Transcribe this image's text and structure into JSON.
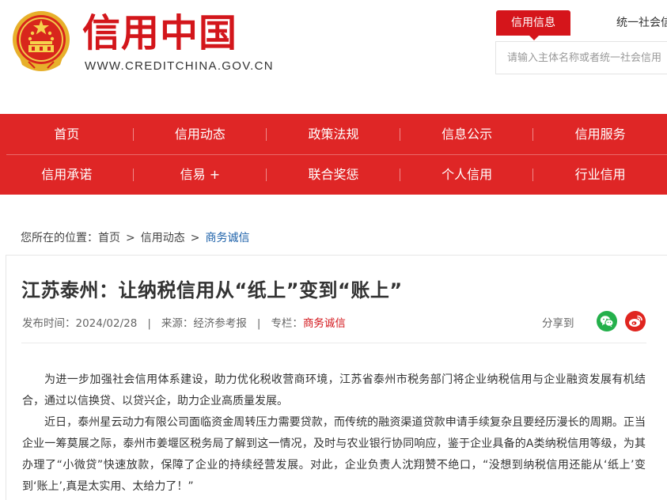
{
  "header": {
    "logo_title": "信用中国",
    "logo_url": "WWW.CREDITCHINA.GOV.CN",
    "search_tabs": [
      "信用信息",
      "统一社会信"
    ],
    "search_placeholder": "请输入主体名称或者统一社会信用"
  },
  "nav": {
    "row1": [
      "首页",
      "信用动态",
      "政策法规",
      "信息公示",
      "信用服务"
    ],
    "row2": [
      "信用承诺",
      "信易 +",
      "联合奖惩",
      "个人信用",
      "行业信用"
    ]
  },
  "breadcrumb": {
    "prefix": "您所在的位置：",
    "items": [
      "首页",
      "信用动态",
      "商务诚信"
    ],
    "separator": ">"
  },
  "article": {
    "title": "江苏泰州：让纳税信用从“纸上”变到“账上”",
    "publish_label": "发布时间：",
    "publish_date": "2024/02/28",
    "source_label": "来源：",
    "source": "经济参考报",
    "column_label": "专栏：",
    "column": "商务诚信",
    "share_label": "分享到",
    "paragraphs": [
      "为进一步加强社会信用体系建设，助力优化税收营商环境，江苏省泰州市税务部门将企业纳税信用与企业融资发展有机结合，通过以信换贷、以贷兴企，助力企业高质量发展。",
      "近日，泰州星云动力有限公司面临资金周转压力需要贷款，而传统的融资渠道贷款申请手续复杂且要经历漫长的周期。正当企业一筹莫展之际，泰州市姜堰区税务局了解到这一情况，及时与农业银行协同响应，鉴于企业具备的A类纳税信用等级，为其办理了“小微贷”快速放款，保障了企业的持续经营发展。对此，企业负责人沈翔赞不绝口，“没想到纳税信用还能从‘纸上’变到‘账上’,真是太实用、太给力了！”"
    ]
  },
  "colors": {
    "brand_red": "#d3161b",
    "nav_red": "#df2626",
    "link_blue": "#1a5fa8",
    "wechat_green": "#24b04b"
  },
  "icons": [
    "national-emblem-icon",
    "wechat-icon",
    "weibo-icon"
  ]
}
